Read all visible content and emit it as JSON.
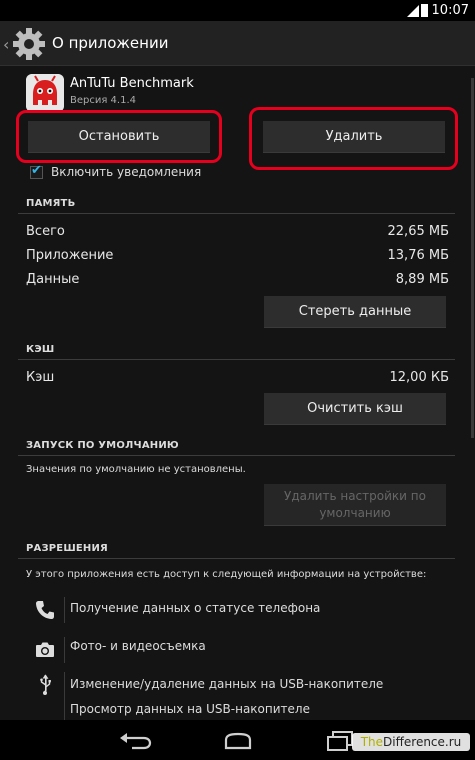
{
  "status_bar": {
    "time": "10:07"
  },
  "action_bar": {
    "title": "О приложении"
  },
  "app": {
    "name": "AnTuTu Benchmark",
    "version": "Версия 4.1.4"
  },
  "buttons": {
    "force_stop": "Остановить",
    "uninstall": "Удалить",
    "clear_data": "Стереть данные",
    "clear_cache": "Очистить кэш",
    "clear_defaults": "Удалить настройки по умолчанию"
  },
  "notifications": {
    "label": "Включить уведомления",
    "checked": true
  },
  "storage": {
    "header": "ПАМЯТЬ",
    "rows": [
      {
        "label": "Всего",
        "value": "22,65 МБ"
      },
      {
        "label": "Приложение",
        "value": "13,76 МБ"
      },
      {
        "label": "Данные",
        "value": "8,89 МБ"
      }
    ]
  },
  "cache": {
    "header": "КЭШ",
    "rows": [
      {
        "label": "Кэш",
        "value": "12,00 КБ"
      }
    ]
  },
  "launch_default": {
    "header": "ЗАПУСК ПО УМОЛЧАНИЮ",
    "text": "Значения по умолчанию не установлены."
  },
  "permissions": {
    "header": "РАЗРЕШЕНИЯ",
    "intro": "У этого приложения есть доступ к следующей информации на устройстве:",
    "items": [
      {
        "icon": "phone-icon",
        "label": "Получение данных о статусе телефона"
      },
      {
        "icon": "camera-icon",
        "label": "Фото- и видеосъемка"
      },
      {
        "icon": "usb-icon",
        "label": "Изменение/удаление данных на USB-накопителе"
      },
      {
        "icon": "usb-icon",
        "label": "Просмотр данных на USB-накопителе"
      }
    ]
  },
  "watermark": {
    "prefix": "The",
    "rest": "Difference.ru"
  },
  "colors": {
    "highlight_ring": "#e6001e",
    "checkbox_accent": "#33b5e5",
    "background": "#141414"
  }
}
